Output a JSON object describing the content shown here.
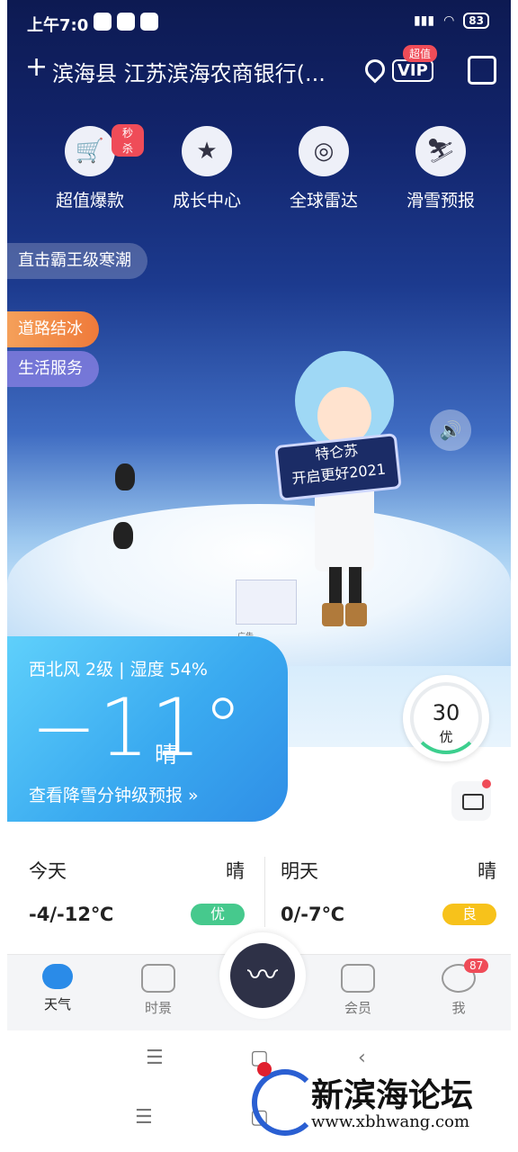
{
  "status": {
    "time": "上午7:0",
    "battery": "83"
  },
  "header": {
    "location": "滨海县 江苏滨海农商银行(...",
    "vip_badge": "超值",
    "vip_label": "VIP"
  },
  "quick_actions": [
    {
      "label": "超值爆款",
      "icon": "cart-icon",
      "badge": "秒杀"
    },
    {
      "label": "成长中心",
      "icon": "medal-icon",
      "badge": ""
    },
    {
      "label": "全球雷达",
      "icon": "radar-globe-icon",
      "badge": ""
    },
    {
      "label": "滑雪预报",
      "icon": "ski-icon",
      "badge": ""
    }
  ],
  "pills": [
    "直击霸王级寒潮",
    "道路结冰",
    "生活服务"
  ],
  "scene": {
    "sign_line1": "特仑苏",
    "sign_line2": "开启更好2021",
    "ad_label": "广告"
  },
  "weather": {
    "wind_humidity": "西北风 2级 | 湿度 54%",
    "temperature": "−11°",
    "condition": "晴",
    "snow_link": "查看降雪分钟级预报 »",
    "aqi_value": "30",
    "aqi_level": "优",
    "aqi_fraction": 0.06
  },
  "forecast": [
    {
      "day": "今天",
      "condition": "晴",
      "range": "-4/-12℃",
      "quality": "优",
      "color": "#46c98d"
    },
    {
      "day": "明天",
      "condition": "晴",
      "range": "0/-7℃",
      "quality": "良",
      "color": "#f7c21b"
    }
  ],
  "nav": [
    {
      "label": "天气",
      "icon": "cloud-icon",
      "active": true,
      "badge": ""
    },
    {
      "label": "时景",
      "icon": "photo-icon",
      "active": false,
      "badge": ""
    },
    {
      "label": "会员",
      "icon": "crown-icon",
      "active": false,
      "badge": ""
    },
    {
      "label": "我",
      "icon": "user-icon",
      "active": false,
      "badge": "87"
    }
  ],
  "watermark": {
    "title": "新滨海论坛",
    "url": "www.xbhwang.com"
  }
}
